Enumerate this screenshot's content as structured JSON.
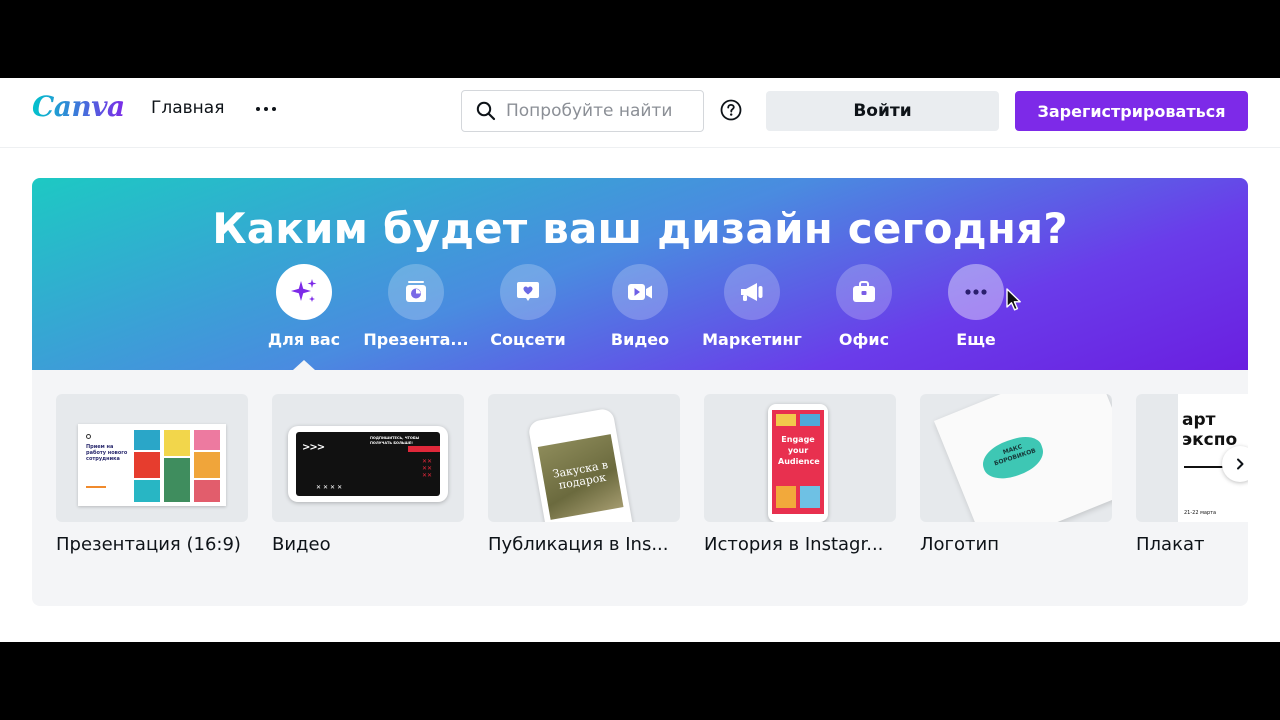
{
  "header": {
    "logo": "Canva",
    "nav_home": "Главная",
    "search_placeholder": "Попробуйте найти",
    "login": "Войти",
    "register": "Зарегистрироваться"
  },
  "hero": {
    "title": "Каким будет ваш дизайн сегодня?",
    "categories": [
      {
        "label": "Для вас",
        "icon": "sparkle-icon"
      },
      {
        "label": "Презента...",
        "icon": "presentation-icon"
      },
      {
        "label": "Соцсети",
        "icon": "heart-chat-icon"
      },
      {
        "label": "Видео",
        "icon": "video-camera-icon"
      },
      {
        "label": "Маркетинг",
        "icon": "megaphone-icon"
      },
      {
        "label": "Офис",
        "icon": "briefcase-icon"
      },
      {
        "label": "Еще",
        "icon": "more-dots-icon"
      }
    ]
  },
  "templates": [
    {
      "label": "Презентация (16:9)",
      "thumb_text": "Прием на работу нового сотрудника"
    },
    {
      "label": "Видео",
      "thumb_text": "ПОДПИШИТЕСЬ, ЧТОБЫ ПОЛУЧАТЬ БОЛЬШЕ!"
    },
    {
      "label": "Публикация в Ins...",
      "thumb_text": "Закуска в подарок"
    },
    {
      "label": "История в Instagr...",
      "thumb_text": "Engage your Audience"
    },
    {
      "label": "Логотип",
      "thumb_text": "МАКС БОРОВИКОВ"
    },
    {
      "label": "Плакат",
      "thumb_text": "арт экспо",
      "thumb_date": "21-22 марта"
    }
  ],
  "colors": {
    "brand": "#7d2ae8",
    "teal": "#00c4cc"
  }
}
